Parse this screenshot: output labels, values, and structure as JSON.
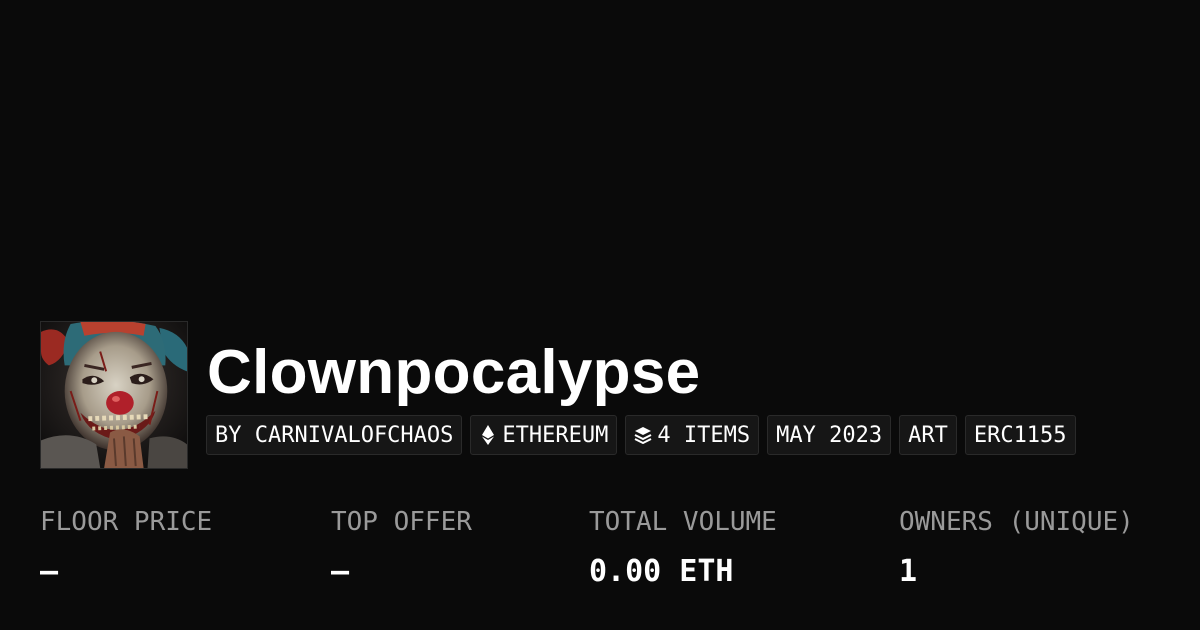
{
  "collection": {
    "name": "Clownpocalypse",
    "avatar_icon": "clown-avatar-image"
  },
  "tags": [
    {
      "label": "BY CARNIVALOFCHAOS"
    },
    {
      "label": "ETHEREUM",
      "icon": "ethereum-icon"
    },
    {
      "label": "4 ITEMS",
      "icon": "layers-icon"
    },
    {
      "label": "MAY 2023"
    },
    {
      "label": "ART"
    },
    {
      "label": "ERC1155"
    }
  ],
  "stats": [
    {
      "label": "FLOOR PRICE",
      "value": "–"
    },
    {
      "label": "TOP OFFER",
      "value": "–"
    },
    {
      "label": "TOTAL VOLUME",
      "value": "0.00 ETH"
    },
    {
      "label": "OWNERS (UNIQUE)",
      "value": "1"
    }
  ],
  "colors": {
    "background": "#0a0a0a",
    "tag_background": "#161616",
    "label_gray": "#9a9a9a",
    "text": "#ffffff"
  }
}
